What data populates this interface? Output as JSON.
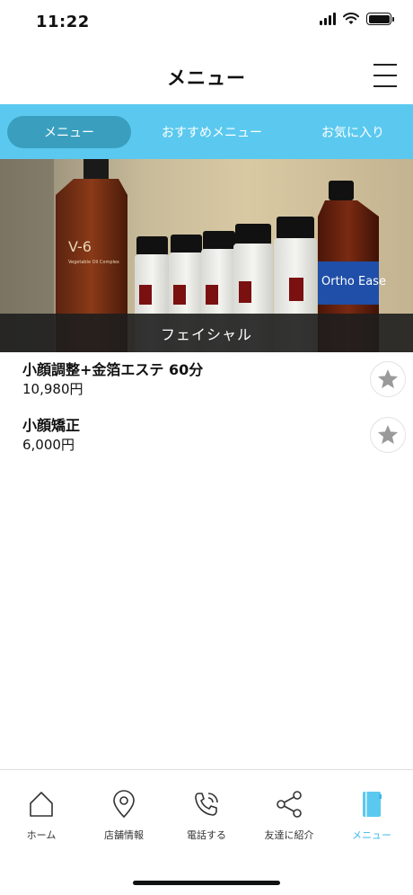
{
  "status_bar": {
    "time": "11:22"
  },
  "header": {
    "title": "メニュー",
    "menu_icon": "hamburger-icon"
  },
  "tabs": [
    {
      "label": "メニュー",
      "active": true
    },
    {
      "label": "おすすめメニュー",
      "active": false
    },
    {
      "label": "お気に入り",
      "active": false
    }
  ],
  "hero": {
    "category": "フェイシャル",
    "bottle_label_left": "V-6",
    "bottle_label_right": "Ortho Ease"
  },
  "items": [
    {
      "name": "小顔調整+金箔エステ 60分",
      "price": "10,980円",
      "icon": "star-icon"
    },
    {
      "name": "小顔矯正",
      "price": "6,000円",
      "icon": "star-icon"
    }
  ],
  "bottom_nav": [
    {
      "label": "ホーム",
      "icon": "home-icon",
      "active": false
    },
    {
      "label": "店舗情報",
      "icon": "map-pin-icon",
      "active": false
    },
    {
      "label": "電話する",
      "icon": "phone-icon",
      "active": false
    },
    {
      "label": "友達に紹介",
      "icon": "share-icon",
      "active": false
    },
    {
      "label": "メニュー",
      "icon": "book-icon",
      "active": true
    }
  ],
  "colors": {
    "accent": "#5bc9ef",
    "active_tab": "#3a9fbf",
    "nav_active": "#3db8e8",
    "star": "#9a9a9a"
  }
}
